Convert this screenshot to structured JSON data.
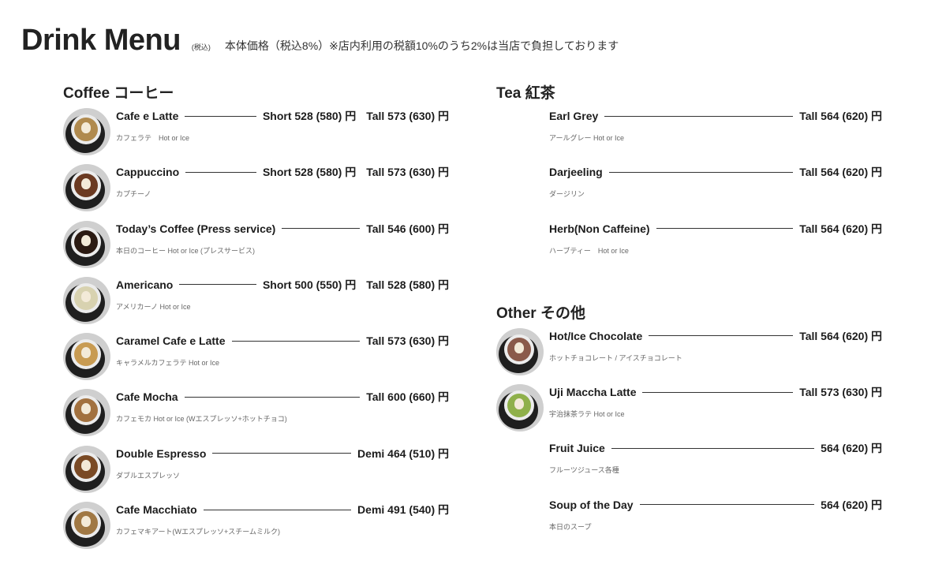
{
  "header": {
    "title": "Drink Menu",
    "tax_small": "(税込)",
    "note": "本体価格（税込8%）※店内利用の税額10%のうち2%は当店で負担しております"
  },
  "coffee": {
    "title": "Coffee コーヒー",
    "items": [
      {
        "name": "Cafe e Latte",
        "sub": "カフェラテ　Hot or Ice",
        "price1": "Short 528 (580) 円",
        "price2": "Tall 573 (630) 円",
        "icon": "latte-art-icon",
        "color": "#b08a4e"
      },
      {
        "name": "Cappuccino",
        "sub": "カプチーノ",
        "price1": "Short 528 (580) 円",
        "price2": "Tall 573 (630) 円",
        "icon": "cappuccino-icon",
        "color": "#6b3a22"
      },
      {
        "name": "Today’s Coffee (Press service)",
        "sub": "本日のコーヒー Hot or Ice (プレスサービス)",
        "price2": "Tall 546 (600) 円",
        "icon": "french-press-icon",
        "color": "#2b1a12"
      },
      {
        "name": "Americano",
        "sub": "アメリカーノ Hot or Ice",
        "price1": "Short 500 (550) 円",
        "price2": "Tall 528 (580) 円",
        "icon": "americano-icon",
        "color": "#d8d2b0"
      },
      {
        "name": "Caramel Cafe e Latte",
        "sub": "キャラメルカフェラテ Hot or Ice",
        "price2": "Tall 573 (630) 円",
        "icon": "caramel-latte-icon",
        "color": "#c89b52"
      },
      {
        "name": "Cafe Mocha",
        "sub": "カフェモカ Hot or Ice (Wエスプレッソ+ホットチョコ)",
        "price2": "Tall 600 (660) 円",
        "icon": "mocha-icon",
        "color": "#a2713f"
      },
      {
        "name": "Double Espresso",
        "sub": "ダブルエスプレッソ",
        "price2": "Demi 464 (510) 円",
        "icon": "espresso-icon",
        "color": "#7a4a25"
      },
      {
        "name": "Cafe Macchiato",
        "sub": "カフェマキアート(Wエスプレッソ+スチームミルク)",
        "price2": "Demi 491 (540) 円",
        "icon": "macchiato-icon",
        "color": "#a07844"
      }
    ]
  },
  "tea": {
    "title": "Tea 紅茶",
    "items": [
      {
        "name": "Earl Grey",
        "sub": "アールグレー Hot or Ice",
        "price2": "Tall 564 (620) 円"
      },
      {
        "name": "Darjeeling",
        "sub": "ダージリン",
        "price2": "Tall 564 (620) 円"
      },
      {
        "name": "Herb(Non Caffeine)",
        "sub": "ハーブティー　Hot or Ice",
        "price2": "Tall 564 (620) 円"
      }
    ]
  },
  "other": {
    "title": "Other その他",
    "items": [
      {
        "name": "Hot/Ice Chocolate",
        "sub": "ホットチョコレート / アイスチョコレート",
        "price2": "Tall 564 (620) 円",
        "icon": "hot-chocolate-icon",
        "color": "#8a5a4a"
      },
      {
        "name": "Uji Maccha Latte",
        "sub": "宇治抹茶ラテ Hot or Ice",
        "price2": "Tall 573 (630) 円",
        "icon": "matcha-latte-icon",
        "color": "#8fb04a"
      },
      {
        "name": "Fruit Juice",
        "sub": "フルーツジュース各種",
        "price2": "564 (620) 円"
      },
      {
        "name": "Soup of the Day",
        "sub": "本日のスープ",
        "price2": "564 (620) 円"
      }
    ]
  }
}
